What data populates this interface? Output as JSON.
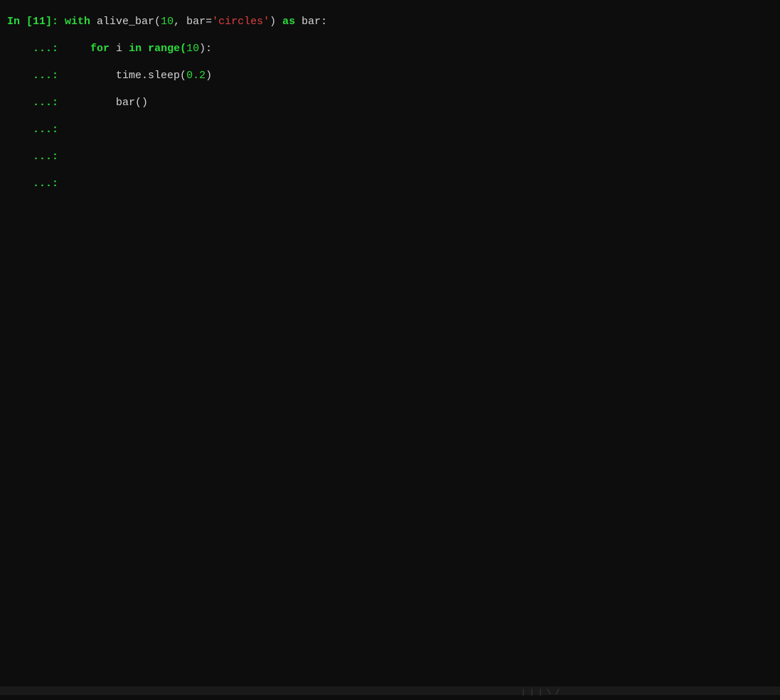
{
  "lines": {
    "line1": {
      "prompt": "In [11]: ",
      "tokens": {
        "with": "with",
        "space1": " ",
        "alive_bar": "alive_bar(",
        "num1": "10",
        "comma_bar": ", bar=",
        "string": "'circles'",
        "close": ") ",
        "as": "as",
        "bar_colon": " bar:"
      }
    },
    "line2": {
      "continuation": "    ...: ",
      "indent": "    ",
      "for": "for",
      "space_i": " i ",
      "in": "in",
      "space": " ",
      "range": "range(",
      "num": "10",
      "close": "):"
    },
    "line3": {
      "continuation": "    ...: ",
      "indent": "        ",
      "time_sleep": "time.sleep(",
      "num": "0.2",
      "close": ")"
    },
    "line4": {
      "continuation": "    ...: ",
      "indent": "        ",
      "bar_call": "bar()"
    },
    "line5": {
      "continuation": "    ...: "
    },
    "line6": {
      "continuation": "    ...: "
    },
    "line7": {
      "continuation": "    ...: "
    }
  },
  "status_bar": "| | |  \\ /"
}
